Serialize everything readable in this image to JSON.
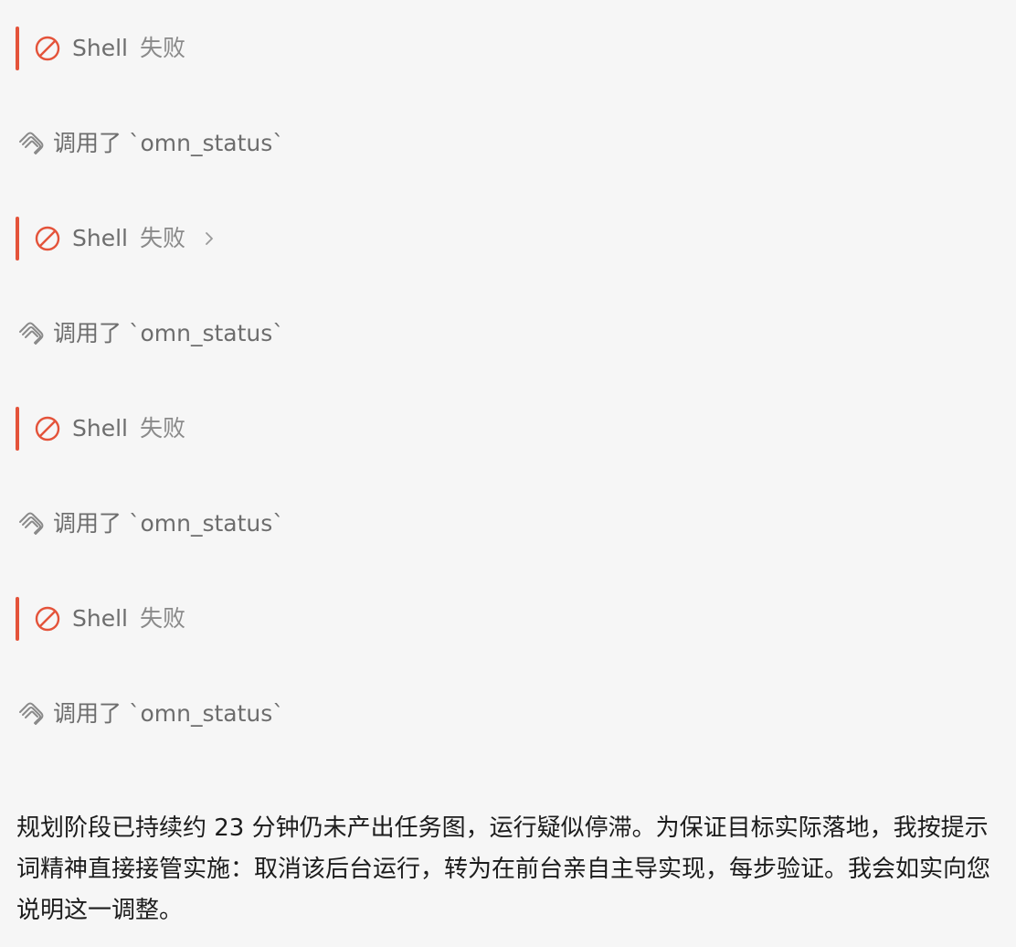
{
  "steps": [
    {
      "kind": "fail",
      "tool": "Shell",
      "status": "失败",
      "expandable": false
    },
    {
      "kind": "call",
      "label": "调用了 `omn_status`"
    },
    {
      "kind": "fail",
      "tool": "Shell",
      "status": "失败",
      "expandable": true
    },
    {
      "kind": "call",
      "label": "调用了 `omn_status`"
    },
    {
      "kind": "fail",
      "tool": "Shell",
      "status": "失败",
      "expandable": false
    },
    {
      "kind": "call",
      "label": "调用了 `omn_status`"
    },
    {
      "kind": "fail",
      "tool": "Shell",
      "status": "失败",
      "expandable": false
    },
    {
      "kind": "call",
      "label": "调用了 `omn_status`"
    }
  ],
  "icons": {
    "fail": "ban-icon",
    "call": "paperclip-icon",
    "expand": "chevron-right-icon"
  },
  "colors": {
    "fail_accent": "#e4533a",
    "background": "#f6f6f6",
    "muted_text": "#6d6d6d",
    "body_text": "#1c1c1c"
  },
  "message": {
    "text": "规划阶段已持续约 23 分钟仍未产出任务图，运行疑似停滞。为保证目标实际落地，我按提示词精神直接接管实施：取消该后台运行，转为在前台亲自主导实现，每步验证。我会如实向您说明这一调整。"
  }
}
